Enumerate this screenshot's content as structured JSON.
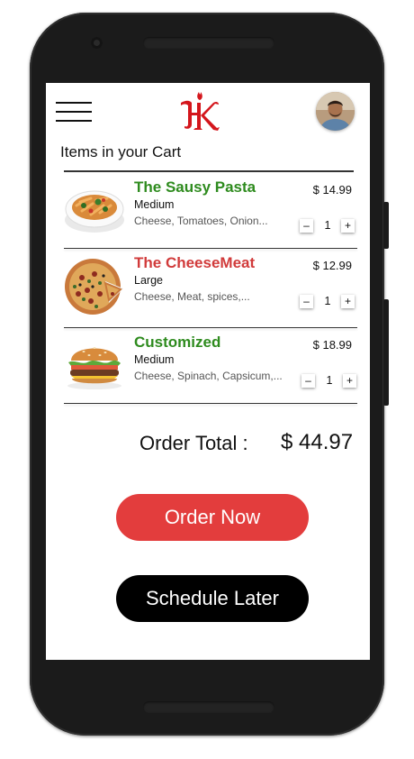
{
  "header": {
    "menu_icon": "hamburger-menu-icon",
    "logo_icon": "hk-logo-icon",
    "avatar_icon": "user-avatar"
  },
  "cart": {
    "title": "Items in your Cart",
    "items": [
      {
        "name": "The Sausy Pasta",
        "name_color": "#2e8b1e",
        "size": "Medium",
        "description": "Cheese, Tomatoes, Onion...",
        "price": "$ 14.99",
        "quantity": "1",
        "image_icon": "pasta-image"
      },
      {
        "name": "The CheeseMeat",
        "name_color": "#d13b3b",
        "size": "Large",
        "description": "Cheese, Meat, spices,...",
        "price": "$ 12.99",
        "quantity": "1",
        "image_icon": "pizza-image"
      },
      {
        "name": "Customized",
        "name_color": "#2e8b1e",
        "size": "Medium",
        "description": "Cheese, Spinach, Capsicum,...",
        "price": "$ 18.99",
        "quantity": "1",
        "image_icon": "burger-image"
      }
    ],
    "minus_label": "–",
    "plus_label": "+"
  },
  "summary": {
    "total_label": "Order Total :",
    "total_value": "$ 44.97"
  },
  "actions": {
    "order_now": "Order Now",
    "schedule_later": "Schedule Later"
  },
  "colors": {
    "accent_red": "#e33d3d",
    "brand_red": "#d4161c",
    "green": "#2e8b1e"
  }
}
